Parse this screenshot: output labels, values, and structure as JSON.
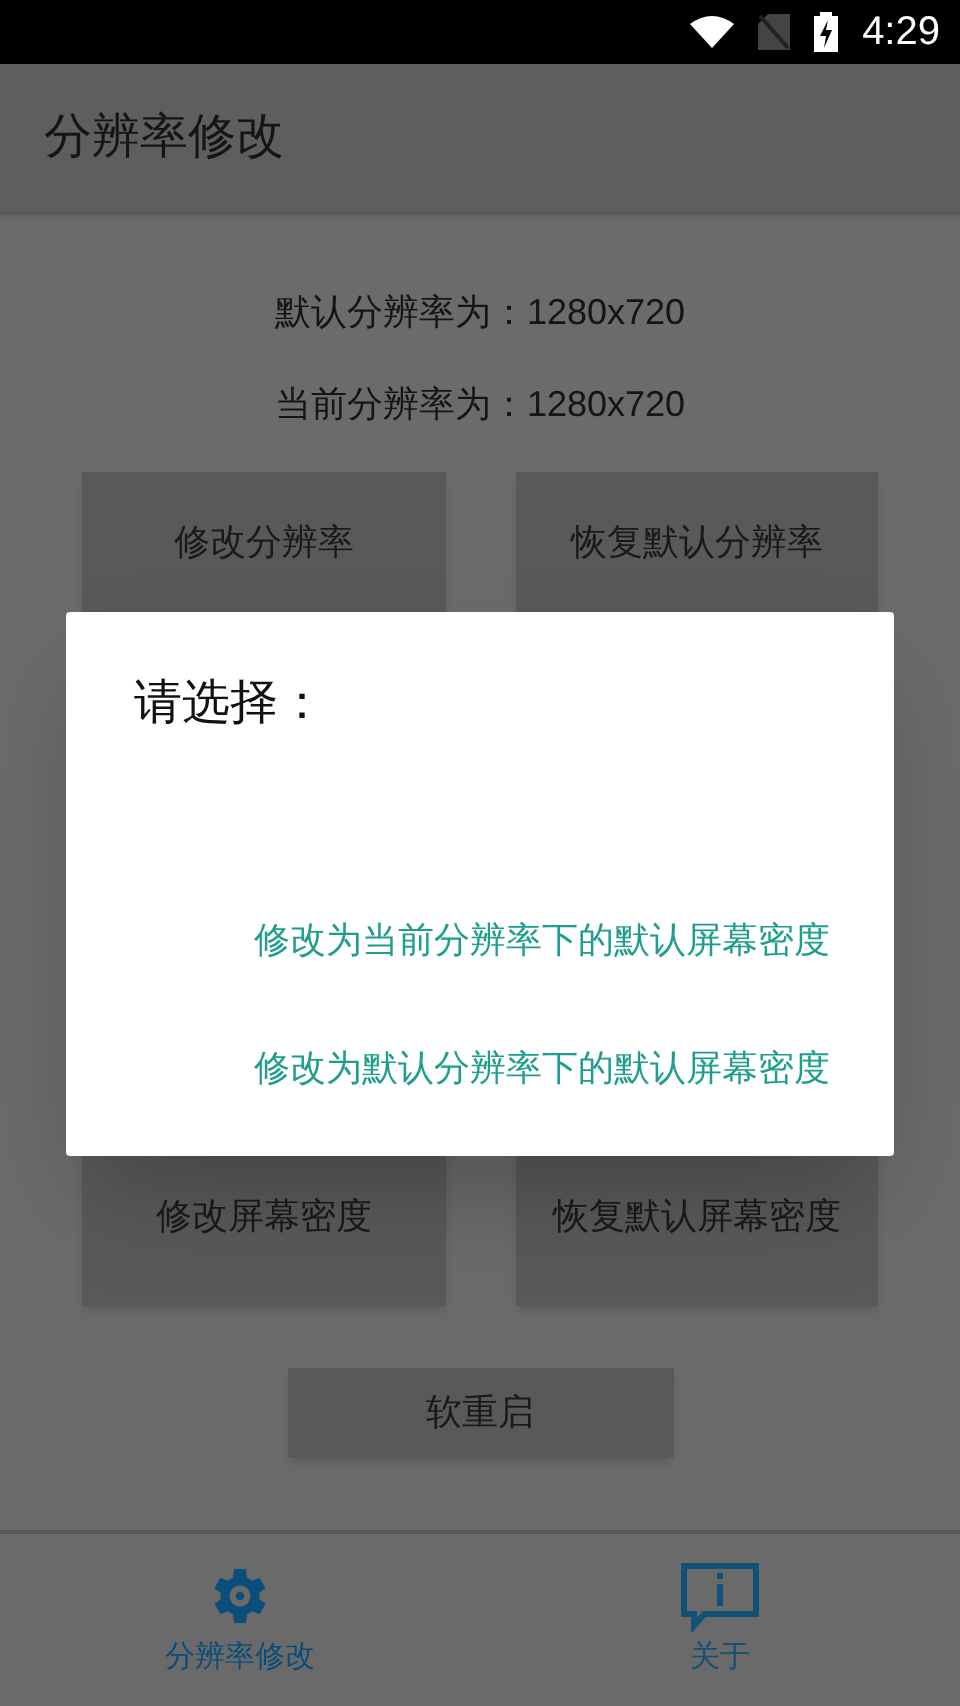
{
  "status_bar": {
    "time": "4:29"
  },
  "app_bar": {
    "title": "分辨率修改"
  },
  "info": [
    "默认分辨率为：1280x720",
    "当前分辨率为：1280x720"
  ],
  "buttons_top": [
    "修改分辨率",
    "恢复默认分辨率"
  ],
  "buttons_bottom": [
    "修改屏幕密度",
    "恢复默认屏幕密度"
  ],
  "reboot_button": "软重启",
  "dialog": {
    "title": "请选择：",
    "options": [
      "修改为当前分辨率下的默认屏幕密度",
      "修改为默认分辨率下的默认屏幕密度"
    ]
  },
  "bottom_nav": [
    {
      "kind": "gear",
      "label": "分辨率修改",
      "selected": true
    },
    {
      "kind": "info",
      "label": "关于",
      "selected": false
    }
  ]
}
